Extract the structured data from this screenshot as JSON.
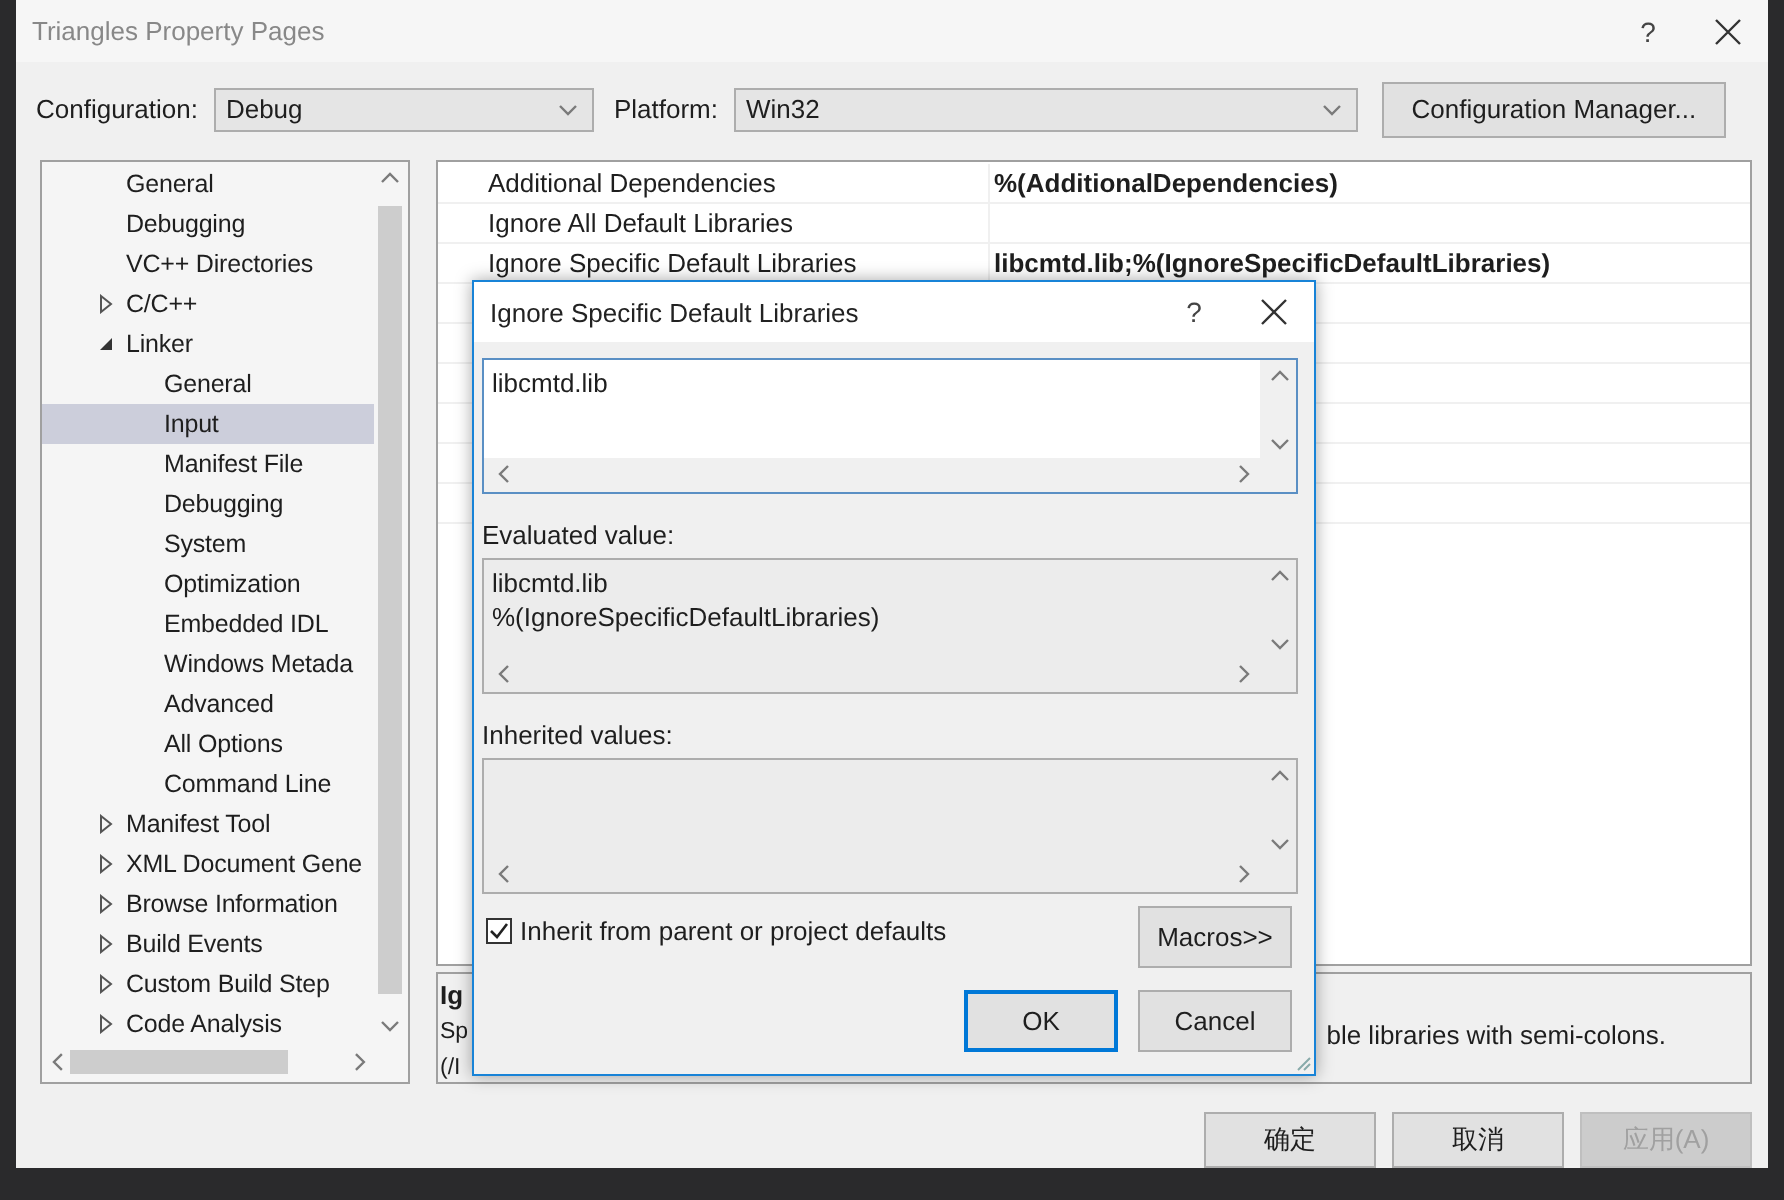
{
  "window": {
    "title": "Triangles Property Pages",
    "help": "?"
  },
  "configuration": {
    "label": "Configuration:",
    "value": "Debug"
  },
  "platform": {
    "label": "Platform:",
    "value": "Win32"
  },
  "config_manager_button": "Configuration Manager...",
  "tree": {
    "items": [
      {
        "label": "General",
        "selected": false
      },
      {
        "label": "Debugging",
        "selected": false
      },
      {
        "label": "VC++ Directories",
        "selected": false
      },
      {
        "label": "C/C++",
        "selected": false,
        "expanded": false
      },
      {
        "label": "Linker",
        "selected": false,
        "expanded": true,
        "children": [
          {
            "label": "General",
            "selected": false
          },
          {
            "label": "Input",
            "selected": true
          },
          {
            "label": "Manifest File",
            "selected": false
          },
          {
            "label": "Debugging",
            "selected": false
          },
          {
            "label": "System",
            "selected": false
          },
          {
            "label": "Optimization",
            "selected": false
          },
          {
            "label": "Embedded IDL",
            "selected": false
          },
          {
            "label": "Windows Metada",
            "selected": false
          },
          {
            "label": "Advanced",
            "selected": false
          },
          {
            "label": "All Options",
            "selected": false
          },
          {
            "label": "Command Line",
            "selected": false
          }
        ]
      },
      {
        "label": "Manifest Tool",
        "selected": false,
        "expanded": false
      },
      {
        "label": "XML Document Gene",
        "selected": false,
        "expanded": false
      },
      {
        "label": "Browse Information",
        "selected": false,
        "expanded": false
      },
      {
        "label": "Build Events",
        "selected": false,
        "expanded": false
      },
      {
        "label": "Custom Build Step",
        "selected": false,
        "expanded": false
      },
      {
        "label": "Code Analysis",
        "selected": false,
        "expanded": false
      }
    ]
  },
  "properties": {
    "rows": [
      {
        "name": "Additional Dependencies",
        "value": "%(AdditionalDependencies)"
      },
      {
        "name": "Ignore All Default Libraries"
      },
      {
        "name": "Ignore Specific Default Libraries",
        "value": "libcmtd.lib;%(IgnoreSpecificDefaultLibraries)"
      }
    ]
  },
  "description": {
    "title": "Ig",
    "lines": [
      "Sp",
      "(/I"
    ],
    "right_fragment": "ble libraries with semi-colons."
  },
  "buttons": [
    {
      "label": "确定",
      "disabled": false
    },
    {
      "label": "取消",
      "disabled": false
    },
    {
      "label": "应用(A)",
      "disabled": true
    }
  ],
  "dialog": {
    "title": "Ignore Specific Default Libraries",
    "help": "?",
    "value": "libcmtd.lib",
    "evaluated_label": "Evaluated value:",
    "evaluated_lines": [
      "libcmtd.lib",
      "%(IgnoreSpecificDefaultLibraries)"
    ],
    "inherited_label": "Inherited values:",
    "inherit_checkbox": {
      "label": "Inherit from parent or project defaults",
      "checked": true
    },
    "macros_button": "Macros>>",
    "buttons": [
      {
        "label": "OK",
        "default": true
      },
      {
        "label": "Cancel",
        "default": false
      }
    ]
  }
}
